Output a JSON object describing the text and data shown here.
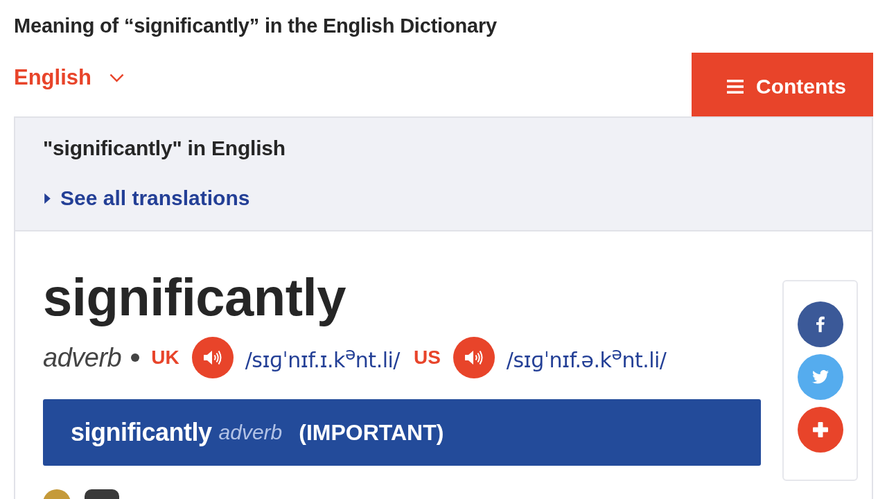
{
  "page_title": "Meaning of “significantly” in the English Dictionary",
  "language_selector": {
    "label": "English"
  },
  "contents_button": {
    "label": "Contents"
  },
  "translations_panel": {
    "heading": "\"significantly\" in English",
    "link": "See all translations"
  },
  "entry": {
    "headword": "significantly",
    "part_of_speech": "adverb",
    "pronunciations": [
      {
        "region": "UK",
        "ipa": "/sɪɡˈnɪf.ɪ.k$^{ə}$nt.li/"
      },
      {
        "region": "US",
        "ipa": "/sɪɡˈnɪf.ə.k$^{ə}$nt.li/"
      }
    ],
    "sense_header": {
      "word": "significantly",
      "part_of_speech": "adverb",
      "guide_word": "(IMPORTANT)"
    }
  },
  "share_buttons": [
    {
      "kind": "facebook"
    },
    {
      "kind": "twitter"
    },
    {
      "kind": "more"
    }
  ]
}
